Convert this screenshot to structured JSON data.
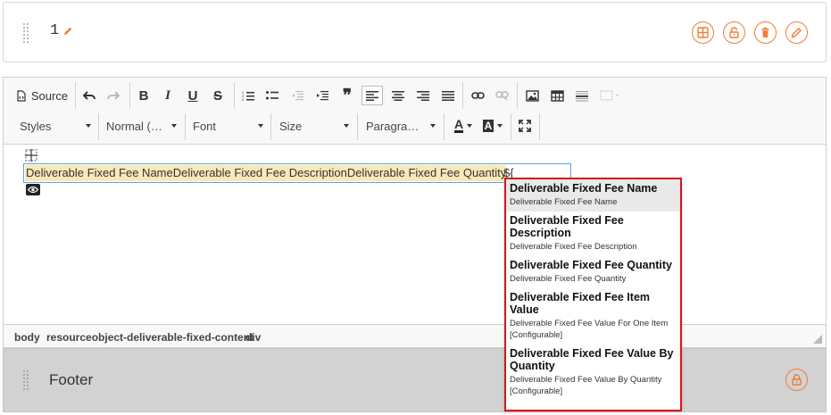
{
  "header_section": {
    "title": "1"
  },
  "toolbar": {
    "source_label": "Source",
    "styles_label": "Styles",
    "format_label": "Normal (…",
    "font_label": "Font",
    "size_label": "Size",
    "paragraph_label": "Paragra…",
    "bold_glyph": "B",
    "italic_glyph": "I",
    "underline_glyph": "U",
    "strike_glyph": "S",
    "text_color_glyph": "A",
    "bg_color_glyph": "A",
    "quote_glyph": "❞"
  },
  "editor": {
    "widget_text": "Deliverable Fixed Fee NameDeliverable Fixed Fee DescriptionDeliverable Fixed Fee Quantity",
    "typed_text": "${"
  },
  "status_path": [
    "body",
    "resourceobject-deliverable-fixed-content",
    "div"
  ],
  "footer": {
    "title": "Footer"
  },
  "autocomplete": [
    {
      "title": "Deliverable Fixed Fee Name",
      "desc": "Deliverable Fixed Fee Name"
    },
    {
      "title": "Deliverable Fixed Fee Description",
      "desc": "Deliverable Fixed Fee Description"
    },
    {
      "title": "Deliverable Fixed Fee Quantity",
      "desc": "Deliverable Fixed Fee Quantity"
    },
    {
      "title": "Deliverable Fixed Fee Item Value",
      "desc": "Deliverable Fixed Fee Value For One Item [Configurable]"
    },
    {
      "title": "Deliverable Fixed Fee Value By Quantity",
      "desc": "Deliverable Fixed Fee Value By Quantity [Configurable]"
    }
  ],
  "colors": {
    "accent": "#f07c33",
    "highlight": "#fbe8b9",
    "focus_border": "#5aa2e0",
    "dropdown_border": "#d9141b"
  }
}
